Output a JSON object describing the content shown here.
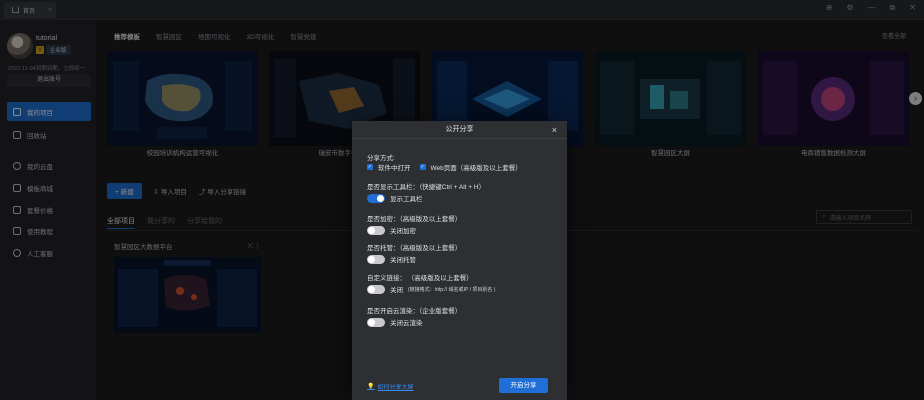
{
  "titlebar": {
    "tab_label": "首页",
    "tab_close": "×",
    "win_buttons": [
      "⊕",
      "⚙",
      "—",
      "⧉",
      "✕"
    ]
  },
  "user": {
    "name": "tutorial",
    "vip_mark": "V",
    "level": "企业版",
    "expire": "2022-11-04到期到期，立即续一",
    "logout": "退出账号"
  },
  "sidebar": {
    "items": [
      {
        "label": "我的项目",
        "icon": "folder-icon",
        "active": true
      },
      {
        "label": "回收站",
        "icon": "trash-icon",
        "active": false
      },
      {
        "label": "我的云盘",
        "icon": "cloud-icon",
        "active": false
      },
      {
        "label": "模板商城",
        "icon": "store-icon",
        "active": false
      },
      {
        "label": "套餐价格",
        "icon": "tag-icon",
        "active": false
      },
      {
        "label": "使用教程",
        "icon": "book-icon",
        "active": false
      },
      {
        "label": "人工客服",
        "icon": "person-icon",
        "active": false
      }
    ]
  },
  "main": {
    "top_tabs": [
      "推荐模板",
      "智慧园区",
      "地图可视化",
      "3D可视化",
      "智慧党建"
    ],
    "switch_link": "查看全部",
    "templates": [
      "校园培训机构运营可视化",
      "瑞安市数字化改革",
      "",
      "智慧园区大屏",
      "电商销售数据检测大屏"
    ],
    "actions": {
      "new": "+ 新建",
      "import": "导入项目",
      "import_link": "导入分享链接"
    },
    "sub_tabs": [
      "全部项目",
      "我分享的",
      "分享给我的"
    ],
    "search_placeholder": "请输入项目名称",
    "project": {
      "title": "智慧园区大数据平台"
    }
  },
  "dialog": {
    "title": "公开分享",
    "share_mode_label": "分享方式:",
    "opt_software": "软件中打开",
    "opt_web": "Web页面（高级版及以上套餐）",
    "toolbar_label": "是否显示工具栏：（快捷键Ctrl + Alt + H）",
    "toolbar_status": "显示工具栏",
    "encrypt_label": "是否加密：（高级版及以上套餐）",
    "encrypt_status": "关闭加密",
    "hosting_label": "是否托管：（高级版及以上套餐）",
    "hosting_status": "关闭托管",
    "custom_label": "自定义链接：   （高级版及以上套餐）",
    "custom_status": "关闭",
    "custom_hint": "(链接格式：http:// 域名或IP / 项目别名 )",
    "cloud_label": "是否开启云渲染：（企业版套餐）",
    "cloud_status": "关闭云渲染",
    "help_link": "如何分享大屏",
    "confirm": "开启分享",
    "close": "×"
  }
}
